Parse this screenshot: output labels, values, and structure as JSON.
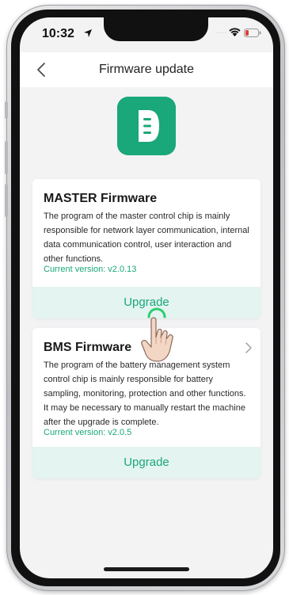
{
  "status_bar": {
    "time": "10:32",
    "signal": "....",
    "wifi_icon": "wifi-icon",
    "battery_icon": "battery-low-icon"
  },
  "nav": {
    "back_icon": "chevron-left-icon",
    "title": "Firmware update"
  },
  "logo": {
    "icon": "app-d-logo-icon",
    "color": "#1aa77a"
  },
  "cards": [
    {
      "title": "MASTER Firmware",
      "description": "The program of the master control chip is mainly responsible for network layer communication, internal data communication control, user interaction and other functions.",
      "version": "Current version: v2.0.13",
      "button": "Upgrade"
    },
    {
      "title": "BMS Firmware",
      "description": "The program of the battery management system control chip is mainly responsible for battery sampling, monitoring, protection and other functions. It may be necessary to manually restart the machine after the upgrade is complete.",
      "version": "Current version: v2.0.5",
      "button": "Upgrade",
      "chevron_icon": "chevron-right-icon"
    }
  ],
  "colors": {
    "accent": "#1aa77a",
    "button_bg": "#e4f4f0",
    "background": "#f3f3f4"
  }
}
